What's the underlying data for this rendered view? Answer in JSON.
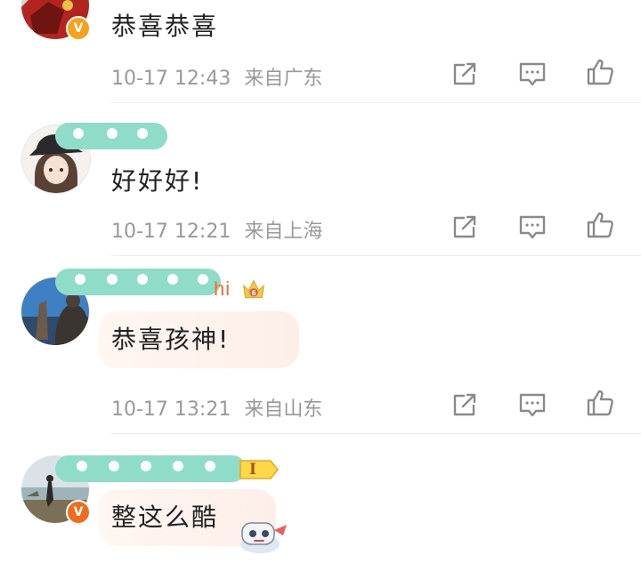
{
  "comments": [
    {
      "text": "恭喜恭喜",
      "timestamp": "10-17 12:43",
      "location": "来自广东",
      "verified": true,
      "avatar_icon": "red-mech-avatar"
    },
    {
      "text": "好好好!",
      "timestamp": "10-17 12:21",
      "location": "来自上海",
      "verified": false,
      "avatar_icon": "anime-girl-hat-avatar"
    },
    {
      "text": "恭喜孩神!",
      "timestamp": "10-17 13:21",
      "location": "来自山东",
      "verified": false,
      "name_tail": "hi",
      "name_badge_icon": "crown-6-icon",
      "avatar_icon": "landscape-statue-avatar"
    },
    {
      "text": "整这么酷",
      "verified": true,
      "name_badge_icon": "level-1-badge-icon",
      "level_badge_text": "I",
      "avatar_icon": "person-by-water-avatar"
    }
  ],
  "actions": {
    "share_icon": "share-icon",
    "comment_icon": "comment-icon",
    "like_icon": "thumbs-up-icon"
  },
  "colors": {
    "text": "#222222",
    "meta": "#999999",
    "name_mask": "#8fdcc9",
    "name_vip": "#ff6a2b",
    "verified": "#f7a21b",
    "divider": "#ececec"
  }
}
